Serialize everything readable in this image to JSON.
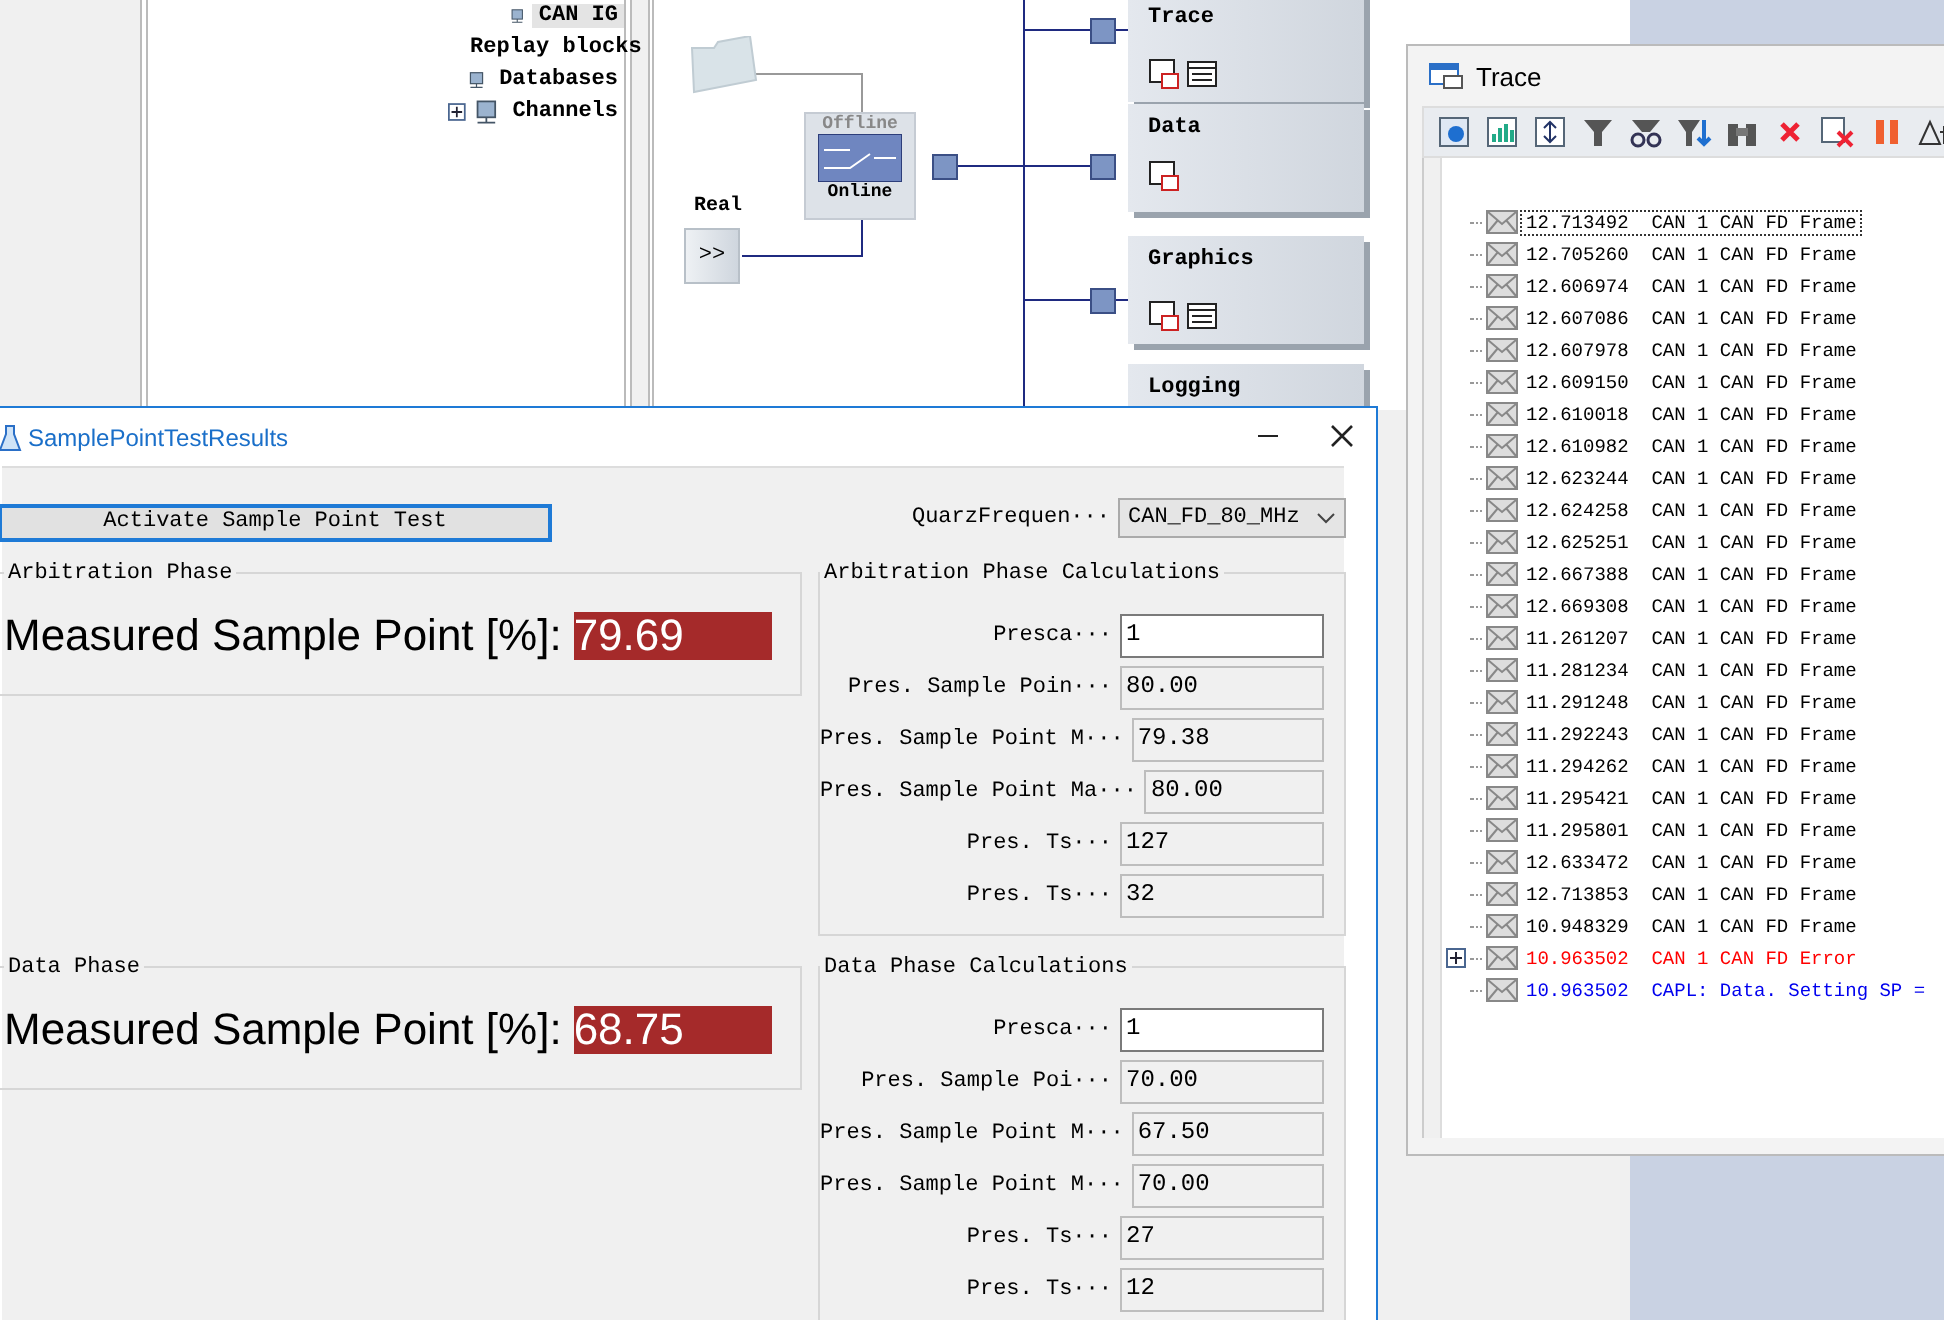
{
  "tree": [
    {
      "label": "CAN IG",
      "selected": true,
      "expandable": false
    },
    {
      "label": "Replay blocks",
      "selected": false,
      "expandable": false
    },
    {
      "label": "Databases",
      "selected": false,
      "expandable": false
    },
    {
      "label": "Channels",
      "selected": false,
      "expandable": true
    }
  ],
  "diagram": {
    "source_label": "Real",
    "source_button": ">>",
    "online": true,
    "switch_top": "Offline",
    "switch_bottom": "Online",
    "blocks": [
      {
        "title": "Trace",
        "kind": "trace"
      },
      {
        "title": "Data",
        "kind": "data"
      },
      {
        "title": "Graphics",
        "kind": "graphics"
      },
      {
        "title": "Logging",
        "kind": "logging"
      }
    ]
  },
  "dialog": {
    "title": "SamplePointTestResults",
    "activate_button": "Activate Sample Point Test",
    "quarz_label": "QuarzFrequen···",
    "quarz_value": "CAN_FD_80_MHz",
    "phases": [
      {
        "title": "Arbitration Phase",
        "measured_label": "Measured Sample Point [%]:",
        "measured_value": "79.69",
        "calc_title": "Arbitration Phase Calculations",
        "fields": [
          {
            "label": "Presca···",
            "value": "1",
            "editable": true
          },
          {
            "label": "Pres. Sample Poin···",
            "value": "80.00",
            "editable": false
          },
          {
            "label": "Pres. Sample Point M···",
            "value": "79.38",
            "editable": false
          },
          {
            "label": "Pres. Sample Point Ma···",
            "value": "80.00",
            "editable": false
          },
          {
            "label": "Pres. Ts···",
            "value": "127",
            "editable": false
          },
          {
            "label": "Pres. Ts···",
            "value": "32",
            "editable": false
          }
        ]
      },
      {
        "title": "Data Phase",
        "measured_label": "Measured Sample Point [%]:",
        "measured_value": "68.75",
        "calc_title": "Data Phase Calculations",
        "fields": [
          {
            "label": "Presca···",
            "value": "1",
            "editable": true
          },
          {
            "label": "Pres. Sample Poi···",
            "value": "70.00",
            "editable": false
          },
          {
            "label": "Pres. Sample Point M···",
            "value": "67.50",
            "editable": false
          },
          {
            "label": "Pres. Sample Point M···",
            "value": "70.00",
            "editable": false
          },
          {
            "label": "Pres. Ts···",
            "value": "27",
            "editable": false
          },
          {
            "label": "Pres. Ts···",
            "value": "12",
            "editable": false
          }
        ]
      }
    ]
  },
  "trace": {
    "title": "Trace",
    "rows": [
      {
        "time": "12.713492",
        "message": "CAN 1 CAN FD Frame",
        "kind": "frame",
        "selected": true,
        "expandable": false
      },
      {
        "time": "12.705260",
        "message": "CAN 1 CAN FD Frame",
        "kind": "frame",
        "selected": false,
        "expandable": false
      },
      {
        "time": "12.606974",
        "message": "CAN 1 CAN FD Frame",
        "kind": "frame",
        "selected": false,
        "expandable": false
      },
      {
        "time": "12.607086",
        "message": "CAN 1 CAN FD Frame",
        "kind": "frame",
        "selected": false,
        "expandable": false
      },
      {
        "time": "12.607978",
        "message": "CAN 1 CAN FD Frame",
        "kind": "frame",
        "selected": false,
        "expandable": false
      },
      {
        "time": "12.609150",
        "message": "CAN 1 CAN FD Frame",
        "kind": "frame",
        "selected": false,
        "expandable": false
      },
      {
        "time": "12.610018",
        "message": "CAN 1 CAN FD Frame",
        "kind": "frame",
        "selected": false,
        "expandable": false
      },
      {
        "time": "12.610982",
        "message": "CAN 1 CAN FD Frame",
        "kind": "frame",
        "selected": false,
        "expandable": false
      },
      {
        "time": "12.623244",
        "message": "CAN 1 CAN FD Frame",
        "kind": "frame",
        "selected": false,
        "expandable": false
      },
      {
        "time": "12.624258",
        "message": "CAN 1 CAN FD Frame",
        "kind": "frame",
        "selected": false,
        "expandable": false
      },
      {
        "time": "12.625251",
        "message": "CAN 1 CAN FD Frame",
        "kind": "frame",
        "selected": false,
        "expandable": false
      },
      {
        "time": "12.667388",
        "message": "CAN 1 CAN FD Frame",
        "kind": "frame",
        "selected": false,
        "expandable": false
      },
      {
        "time": "12.669308",
        "message": "CAN 1 CAN FD Frame",
        "kind": "frame",
        "selected": false,
        "expandable": false
      },
      {
        "time": "11.261207",
        "message": "CAN 1 CAN FD Frame",
        "kind": "frame",
        "selected": false,
        "expandable": false
      },
      {
        "time": "11.281234",
        "message": "CAN 1 CAN FD Frame",
        "kind": "frame",
        "selected": false,
        "expandable": false
      },
      {
        "time": "11.291248",
        "message": "CAN 1 CAN FD Frame",
        "kind": "frame",
        "selected": false,
        "expandable": false
      },
      {
        "time": "11.292243",
        "message": "CAN 1 CAN FD Frame",
        "kind": "frame",
        "selected": false,
        "expandable": false
      },
      {
        "time": "11.294262",
        "message": "CAN 1 CAN FD Frame",
        "kind": "frame",
        "selected": false,
        "expandable": false
      },
      {
        "time": "11.295421",
        "message": "CAN 1 CAN FD Frame",
        "kind": "frame",
        "selected": false,
        "expandable": false
      },
      {
        "time": "11.295801",
        "message": "CAN 1 CAN FD Frame",
        "kind": "frame",
        "selected": false,
        "expandable": false
      },
      {
        "time": "12.633472",
        "message": "CAN 1 CAN FD Frame",
        "kind": "frame",
        "selected": false,
        "expandable": false
      },
      {
        "time": "12.713853",
        "message": "CAN 1 CAN FD Frame",
        "kind": "frame",
        "selected": false,
        "expandable": false
      },
      {
        "time": "10.948329",
        "message": "CAN 1 CAN FD Frame",
        "kind": "frame",
        "selected": false,
        "expandable": false
      },
      {
        "time": "10.963502",
        "message": "CAN 1 CAN FD Error",
        "kind": "error",
        "selected": false,
        "expandable": true
      },
      {
        "time": "10.963502",
        "message": "CAPL: Data. Setting SP =",
        "kind": "capl",
        "selected": false,
        "expandable": false
      }
    ]
  }
}
